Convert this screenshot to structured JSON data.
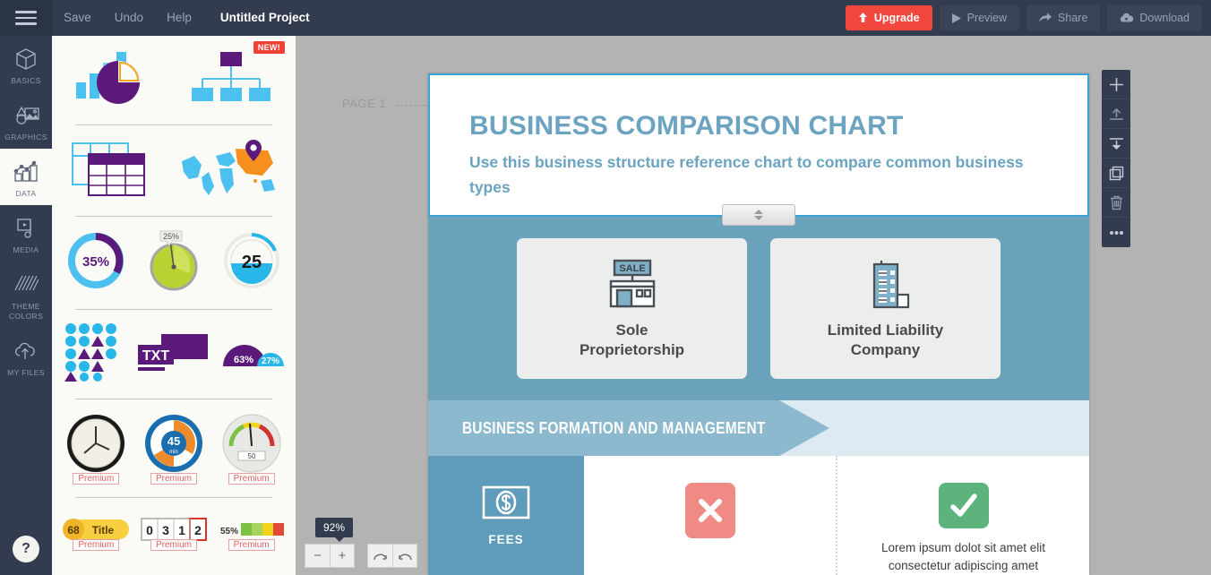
{
  "topbar": {
    "menu_icon": "hamburger-icon",
    "items": [
      {
        "label": "Save",
        "name": "save"
      },
      {
        "label": "Undo",
        "name": "undo"
      },
      {
        "label": "Help",
        "name": "help"
      }
    ],
    "project_title": "Untitled Project",
    "actions": [
      {
        "label": "Upgrade",
        "icon": "arrow-up-icon",
        "accent": "#f2473f"
      },
      {
        "label": "Preview",
        "icon": "play-icon"
      },
      {
        "label": "Share",
        "icon": "share-arrow-icon"
      },
      {
        "label": "Download",
        "icon": "cloud-download-icon"
      }
    ]
  },
  "sidebar": {
    "items": [
      {
        "label": "BASICS",
        "icon": "cube-icon",
        "active": false
      },
      {
        "label": "GRAPHICS",
        "icon": "image-shapes-icon",
        "active": false
      },
      {
        "label": "DATA",
        "icon": "bar-chart-icon",
        "active": true
      },
      {
        "label": "MEDIA",
        "icon": "video-play-icon",
        "active": false
      },
      {
        "label": "THEME COLORS",
        "icon": "color-swatch-icon",
        "active": false
      },
      {
        "label": "MY FILES",
        "icon": "cloud-upload-icon",
        "active": false
      }
    ],
    "help_label": "?"
  },
  "panel": {
    "thumbs": [
      {
        "name": "charts-thumb",
        "badge": null,
        "premium": null
      },
      {
        "name": "org-chart-thumb",
        "badge": "NEW!",
        "premium": null
      },
      {
        "name": "table-thumb",
        "badge": null,
        "premium": null
      },
      {
        "name": "map-thumb",
        "badge": null,
        "premium": null
      },
      {
        "name": "donut-35-thumb",
        "value": "35%",
        "badge": null,
        "premium": null
      },
      {
        "name": "pie-gauge-25-thumb",
        "value": "25%",
        "badge": null,
        "premium": null
      },
      {
        "name": "liquid-25-thumb",
        "value": "25",
        "badge": null,
        "premium": null
      },
      {
        "name": "pictogram-thumb",
        "badge": null,
        "premium": null
      },
      {
        "name": "text-ribbon-thumb",
        "value": "TXT",
        "badge": null,
        "premium": null
      },
      {
        "name": "semicircle-thumb",
        "value_a": "63%",
        "value_b": "27%",
        "badge": null,
        "premium": null
      },
      {
        "name": "clock-thumb",
        "premium": "Premium"
      },
      {
        "name": "timer-45-thumb",
        "value": "45",
        "unit": "min",
        "premium": "Premium"
      },
      {
        "name": "speedometer-50-thumb",
        "value": "50",
        "premium": "Premium"
      },
      {
        "name": "counter-title-thumb",
        "value": "68",
        "label": "Title",
        "premium": "Premium"
      },
      {
        "name": "digit-counter-thumb",
        "digits": [
          "0",
          "3",
          "1",
          "2"
        ],
        "premium": "Premium"
      },
      {
        "name": "progress-55-thumb",
        "value": "55%",
        "premium": "Premium"
      }
    ]
  },
  "canvas": {
    "page_label": "PAGE 1",
    "zoom": {
      "level": "92%",
      "minus": "−",
      "plus": "+",
      "undo_icon": "undo-arrow-icon",
      "redo_icon": "redo-arrow-icon"
    },
    "float_tools": [
      {
        "name": "add-element",
        "icon": "plus-icon"
      },
      {
        "name": "bring-to-front",
        "icon": "arrow-up-to-line-icon"
      },
      {
        "name": "send-to-back",
        "icon": "arrow-down-to-line-icon"
      },
      {
        "name": "duplicate",
        "icon": "copy-icon"
      },
      {
        "name": "delete",
        "icon": "trash-icon"
      },
      {
        "name": "more-options",
        "icon": "ellipsis-icon"
      }
    ]
  },
  "document": {
    "title": "BUSINESS COMPARISON CHART",
    "subtitle": "Use this business structure reference chart to compare common business types",
    "title_color": "#6ba3c0",
    "business_types": [
      {
        "label": "Sole\nProprietorship",
        "label_line1": "Sole",
        "label_line2": "Proprietorship",
        "icon": "storefront-sale-icon"
      },
      {
        "label": "Limited Liability\nCompany",
        "label_line1": "Limited Liability",
        "label_line2": "Company",
        "icon": "office-building-icon"
      }
    ],
    "section_banner": "BUSINESS FORMATION AND MANAGEMENT",
    "row": {
      "head_label": "FEES",
      "head_icon": "money-dollar-icon",
      "cells": [
        {
          "mark": "x",
          "mark_glyph": "✕",
          "mark_color": "#ef8a84",
          "text": ""
        },
        {
          "mark": "check",
          "mark_glyph": "✓",
          "mark_color": "#5cb37c",
          "text": "Lorem ipsum dolot sit amet elit consectetur adipiscing amet"
        }
      ]
    }
  }
}
